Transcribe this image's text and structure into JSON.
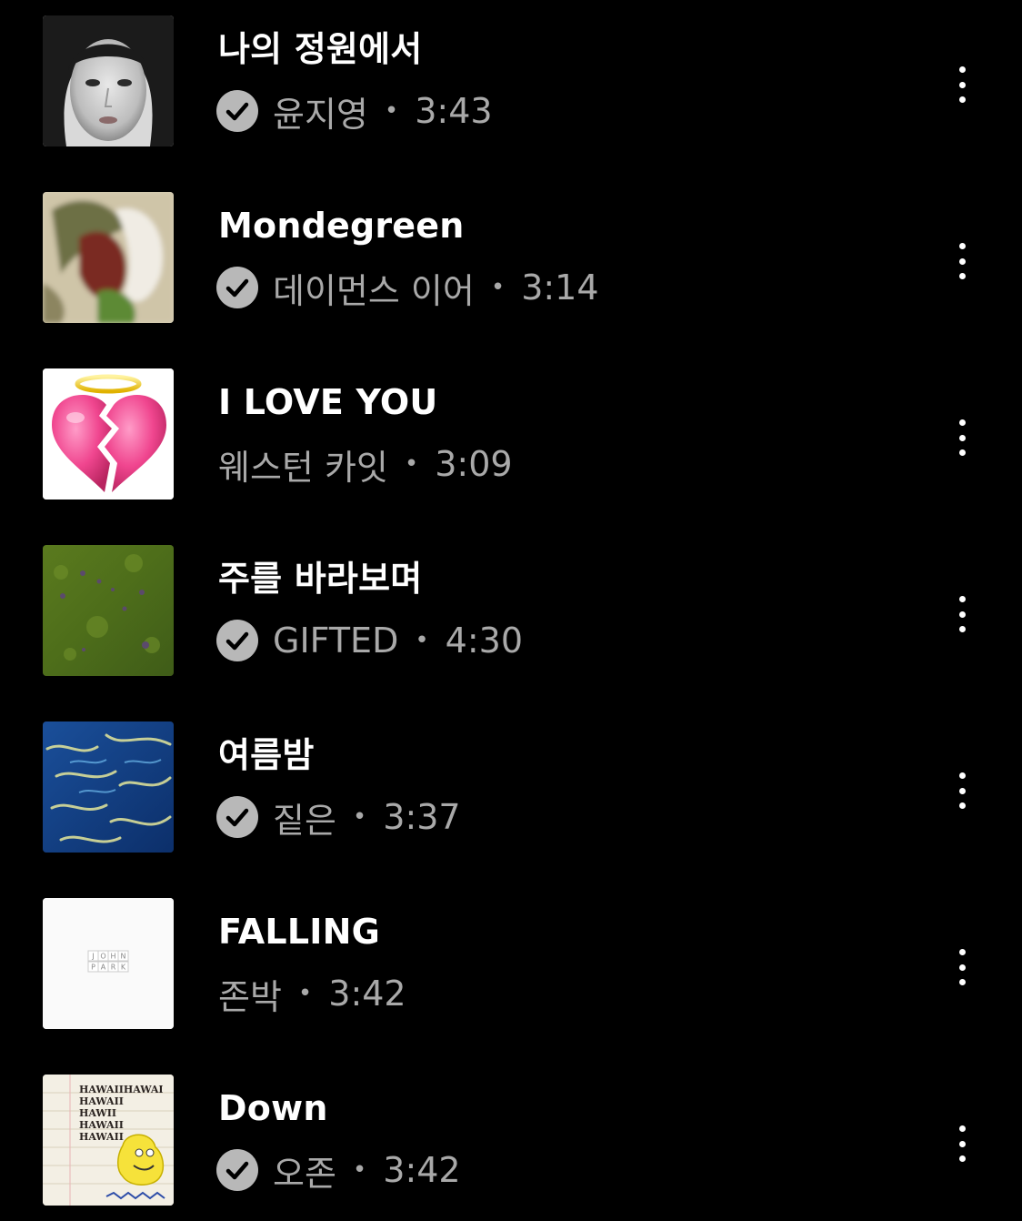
{
  "tracks": [
    {
      "title": "나의 정원에서",
      "artist": "윤지영",
      "duration": "3:43",
      "verified": true,
      "art": "portrait-bw"
    },
    {
      "title": "Mondegreen",
      "artist": "데이먼스 이어",
      "duration": "3:14",
      "verified": true,
      "art": "blurred-figure"
    },
    {
      "title": "I LOVE YOU",
      "artist": "웨스턴 카잇",
      "duration": "3:09",
      "verified": false,
      "art": "broken-heart-halo"
    },
    {
      "title": "주를 바라보며",
      "artist": "GIFTED",
      "duration": "4:30",
      "verified": true,
      "art": "green-field"
    },
    {
      "title": "여름밤",
      "artist": "짙은",
      "duration": "3:37",
      "verified": true,
      "art": "blue-water"
    },
    {
      "title": "FALLING",
      "artist": "존박",
      "duration": "3:42",
      "verified": false,
      "art": "white-john-park"
    },
    {
      "title": "Down",
      "artist": "오존",
      "duration": "3:42",
      "verified": true,
      "art": "hawaii-sketch"
    }
  ],
  "separator": "•",
  "thumb_art_text": {
    "john_park": [
      "J",
      "O",
      "H",
      "N",
      "P",
      "A",
      "R",
      "K"
    ],
    "hawaii": [
      "HAWAIIHAWAI",
      "HAWAII",
      "HAWII",
      "HAWAII",
      "HAWAII"
    ]
  },
  "colors": {
    "background": "#000000",
    "title": "#ffffff",
    "meta": "#a9a9a9",
    "verified_badge": "#b8b8b8"
  },
  "icons": {
    "verified": "check-circle-icon",
    "more": "more-vertical-icon"
  }
}
